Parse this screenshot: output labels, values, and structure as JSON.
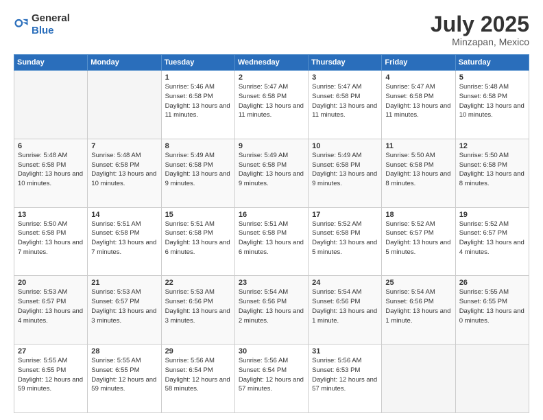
{
  "logo": {
    "general": "General",
    "blue": "Blue"
  },
  "title": {
    "month_year": "July 2025",
    "location": "Minzapan, Mexico"
  },
  "days_of_week": [
    "Sunday",
    "Monday",
    "Tuesday",
    "Wednesday",
    "Thursday",
    "Friday",
    "Saturday"
  ],
  "weeks": [
    [
      {
        "day": "",
        "info": ""
      },
      {
        "day": "",
        "info": ""
      },
      {
        "day": "1",
        "info": "Sunrise: 5:46 AM\nSunset: 6:58 PM\nDaylight: 13 hours and 11 minutes."
      },
      {
        "day": "2",
        "info": "Sunrise: 5:47 AM\nSunset: 6:58 PM\nDaylight: 13 hours and 11 minutes."
      },
      {
        "day": "3",
        "info": "Sunrise: 5:47 AM\nSunset: 6:58 PM\nDaylight: 13 hours and 11 minutes."
      },
      {
        "day": "4",
        "info": "Sunrise: 5:47 AM\nSunset: 6:58 PM\nDaylight: 13 hours and 11 minutes."
      },
      {
        "day": "5",
        "info": "Sunrise: 5:48 AM\nSunset: 6:58 PM\nDaylight: 13 hours and 10 minutes."
      }
    ],
    [
      {
        "day": "6",
        "info": "Sunrise: 5:48 AM\nSunset: 6:58 PM\nDaylight: 13 hours and 10 minutes."
      },
      {
        "day": "7",
        "info": "Sunrise: 5:48 AM\nSunset: 6:58 PM\nDaylight: 13 hours and 10 minutes."
      },
      {
        "day": "8",
        "info": "Sunrise: 5:49 AM\nSunset: 6:58 PM\nDaylight: 13 hours and 9 minutes."
      },
      {
        "day": "9",
        "info": "Sunrise: 5:49 AM\nSunset: 6:58 PM\nDaylight: 13 hours and 9 minutes."
      },
      {
        "day": "10",
        "info": "Sunrise: 5:49 AM\nSunset: 6:58 PM\nDaylight: 13 hours and 9 minutes."
      },
      {
        "day": "11",
        "info": "Sunrise: 5:50 AM\nSunset: 6:58 PM\nDaylight: 13 hours and 8 minutes."
      },
      {
        "day": "12",
        "info": "Sunrise: 5:50 AM\nSunset: 6:58 PM\nDaylight: 13 hours and 8 minutes."
      }
    ],
    [
      {
        "day": "13",
        "info": "Sunrise: 5:50 AM\nSunset: 6:58 PM\nDaylight: 13 hours and 7 minutes."
      },
      {
        "day": "14",
        "info": "Sunrise: 5:51 AM\nSunset: 6:58 PM\nDaylight: 13 hours and 7 minutes."
      },
      {
        "day": "15",
        "info": "Sunrise: 5:51 AM\nSunset: 6:58 PM\nDaylight: 13 hours and 6 minutes."
      },
      {
        "day": "16",
        "info": "Sunrise: 5:51 AM\nSunset: 6:58 PM\nDaylight: 13 hours and 6 minutes."
      },
      {
        "day": "17",
        "info": "Sunrise: 5:52 AM\nSunset: 6:58 PM\nDaylight: 13 hours and 5 minutes."
      },
      {
        "day": "18",
        "info": "Sunrise: 5:52 AM\nSunset: 6:57 PM\nDaylight: 13 hours and 5 minutes."
      },
      {
        "day": "19",
        "info": "Sunrise: 5:52 AM\nSunset: 6:57 PM\nDaylight: 13 hours and 4 minutes."
      }
    ],
    [
      {
        "day": "20",
        "info": "Sunrise: 5:53 AM\nSunset: 6:57 PM\nDaylight: 13 hours and 4 minutes."
      },
      {
        "day": "21",
        "info": "Sunrise: 5:53 AM\nSunset: 6:57 PM\nDaylight: 13 hours and 3 minutes."
      },
      {
        "day": "22",
        "info": "Sunrise: 5:53 AM\nSunset: 6:56 PM\nDaylight: 13 hours and 3 minutes."
      },
      {
        "day": "23",
        "info": "Sunrise: 5:54 AM\nSunset: 6:56 PM\nDaylight: 13 hours and 2 minutes."
      },
      {
        "day": "24",
        "info": "Sunrise: 5:54 AM\nSunset: 6:56 PM\nDaylight: 13 hours and 1 minute."
      },
      {
        "day": "25",
        "info": "Sunrise: 5:54 AM\nSunset: 6:56 PM\nDaylight: 13 hours and 1 minute."
      },
      {
        "day": "26",
        "info": "Sunrise: 5:55 AM\nSunset: 6:55 PM\nDaylight: 13 hours and 0 minutes."
      }
    ],
    [
      {
        "day": "27",
        "info": "Sunrise: 5:55 AM\nSunset: 6:55 PM\nDaylight: 12 hours and 59 minutes."
      },
      {
        "day": "28",
        "info": "Sunrise: 5:55 AM\nSunset: 6:55 PM\nDaylight: 12 hours and 59 minutes."
      },
      {
        "day": "29",
        "info": "Sunrise: 5:56 AM\nSunset: 6:54 PM\nDaylight: 12 hours and 58 minutes."
      },
      {
        "day": "30",
        "info": "Sunrise: 5:56 AM\nSunset: 6:54 PM\nDaylight: 12 hours and 57 minutes."
      },
      {
        "day": "31",
        "info": "Sunrise: 5:56 AM\nSunset: 6:53 PM\nDaylight: 12 hours and 57 minutes."
      },
      {
        "day": "",
        "info": ""
      },
      {
        "day": "",
        "info": ""
      }
    ]
  ]
}
